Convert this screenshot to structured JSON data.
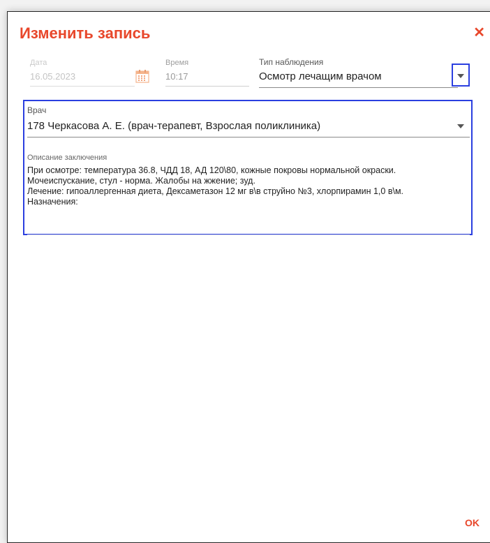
{
  "dialog": {
    "title": "Изменить запись",
    "close_glyph": "✕",
    "ok_label": "OK",
    "accent_color": "#e8472b",
    "highlight_color": "#2b3fe0"
  },
  "date": {
    "label": "Дата",
    "value": "16.05.2023",
    "icon": "calendar-icon"
  },
  "time": {
    "label": "Время",
    "value": "10:17"
  },
  "observation_type": {
    "label": "Тип наблюдения",
    "value": "Осмотр лечащим врачом",
    "icon": "chevron-down-icon"
  },
  "doctor": {
    "label": "Врач",
    "value": "178 Черкасова А. Е. (врач-терапевт, Взрослая поликлиника)",
    "icon": "chevron-down-icon"
  },
  "conclusion": {
    "label": "Описание заключения",
    "text": "При осмотре: температура 36.8, ЧДД 18, АД 120\\80, кожные покровы нормальной окраски.\nМочеиспускание, стул - норма. Жалобы на жжение; зуд.\nЛечение: гипоаллергенная диета, Дексаметазон 12 мг в\\в струйно №3, хлорпирамин 1,0 в\\м.\nНазначения:"
  }
}
